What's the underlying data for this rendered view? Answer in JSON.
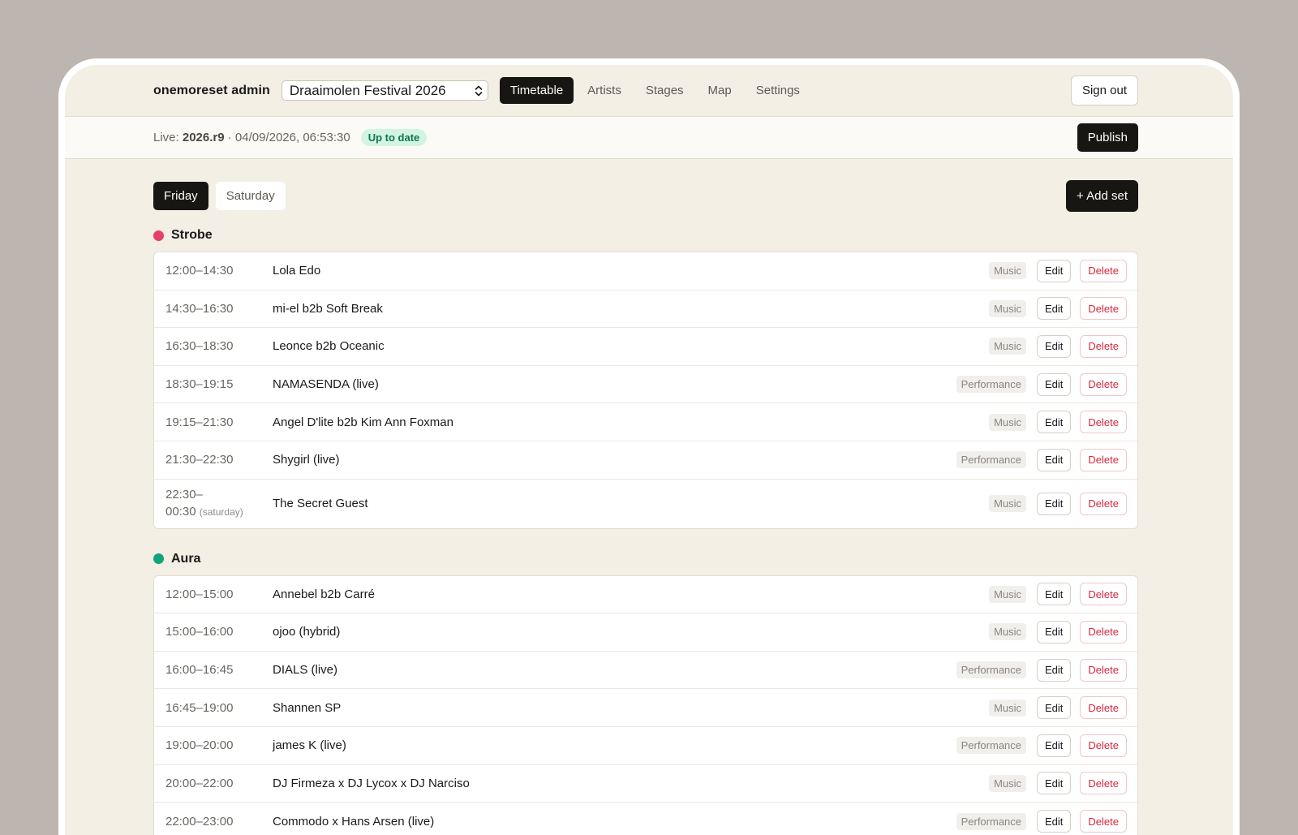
{
  "header": {
    "brand": "onemoreset admin",
    "festival": "Draaimolen Festival 2026",
    "tabs": [
      {
        "label": "Timetable",
        "active": true
      },
      {
        "label": "Artists",
        "active": false
      },
      {
        "label": "Stages",
        "active": false
      },
      {
        "label": "Map",
        "active": false
      },
      {
        "label": "Settings",
        "active": false
      }
    ],
    "sign_out": "Sign out"
  },
  "status": {
    "live_prefix": "Live: ",
    "revision": "2026.r9",
    "separator": " · ",
    "timestamp": "04/09/2026, 06:53:30",
    "badge": "Up to date",
    "publish": "Publish"
  },
  "days": [
    {
      "label": "Friday",
      "active": true
    },
    {
      "label": "Saturday",
      "active": false
    }
  ],
  "add_set": "+ Add set",
  "actions": {
    "edit": "Edit",
    "delete": "Delete"
  },
  "colors": {
    "strobe": "#e83e6c",
    "aura": "#12a37a"
  },
  "stages": [
    {
      "name": "Strobe",
      "color": "#e83e6c",
      "sets": [
        {
          "time": "12:00–14:30",
          "artist": "Lola Edo",
          "type": "Music"
        },
        {
          "time": "14:30–16:30",
          "artist": "mi-el b2b Soft Break",
          "type": "Music"
        },
        {
          "time": "16:30–18:30",
          "artist": "Leonce b2b Oceanic",
          "type": "Music"
        },
        {
          "time": "18:30–19:15",
          "artist": "NAMASENDA (live)",
          "type": "Performance"
        },
        {
          "time": "19:15–21:30",
          "artist": "Angel D'lite b2b Kim Ann Foxman",
          "type": "Music"
        },
        {
          "time": "21:30–22:30",
          "artist": "Shygirl (live)",
          "type": "Performance"
        },
        {
          "time_start": "22:30–",
          "time_end": "00:30",
          "note": "(saturday)",
          "artist": "The Secret Guest",
          "type": "Music"
        }
      ]
    },
    {
      "name": "Aura",
      "color": "#12a37a",
      "sets": [
        {
          "time": "12:00–15:00",
          "artist": "Annebel b2b Carré",
          "type": "Music"
        },
        {
          "time": "15:00–16:00",
          "artist": "ojoo (hybrid)",
          "type": "Music"
        },
        {
          "time": "16:00–16:45",
          "artist": "DIALS (live)",
          "type": "Performance"
        },
        {
          "time": "16:45–19:00",
          "artist": "Shannen SP",
          "type": "Music"
        },
        {
          "time": "19:00–20:00",
          "artist": "james K (live)",
          "type": "Performance"
        },
        {
          "time": "20:00–22:00",
          "artist": "DJ Firmeza x DJ Lycox x DJ Narciso",
          "type": "Music"
        },
        {
          "time": "22:00–23:00",
          "artist": "Commodo x Hans Arsen (live)",
          "type": "Performance"
        }
      ]
    }
  ]
}
